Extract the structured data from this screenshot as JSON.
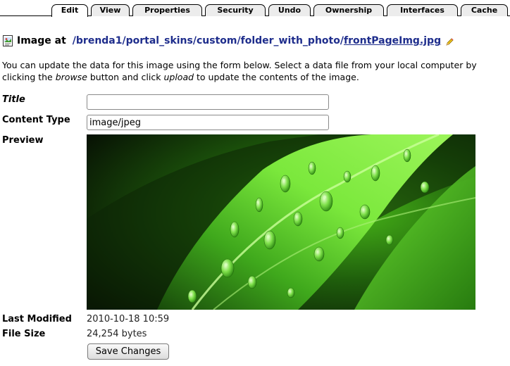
{
  "tabs": [
    {
      "label": "Edit",
      "active": true
    },
    {
      "label": "View",
      "active": false
    },
    {
      "label": "Properties",
      "active": false
    },
    {
      "label": "Security",
      "active": false
    },
    {
      "label": "Undo",
      "active": false
    },
    {
      "label": "Ownership",
      "active": false
    },
    {
      "label": "Interfaces",
      "active": false
    },
    {
      "label": "Cache",
      "active": false
    }
  ],
  "header": {
    "icon": "image-document-icon",
    "label": "Image at",
    "path": [
      "/brenda1",
      "portal_skins",
      "custom",
      "folder_with_photo",
      "frontPageImg.jpg"
    ],
    "separator": "/",
    "edit_icon": "pencil-icon"
  },
  "intro": {
    "part1": "You can update the data for this image using the form below. Select a data file from your local computer by clicking the ",
    "em1": "browse",
    "part2": " button and click ",
    "em2": "upload",
    "part3": " to update the contents of the image."
  },
  "form": {
    "title_label": "Title",
    "title_value": "",
    "content_type_label": "Content Type",
    "content_type_value": "image/jpeg",
    "preview_label": "Preview",
    "preview_image": "green-leaf-with-water-droplets",
    "last_modified_label": "Last Modified",
    "last_modified_value": "2010-10-18 10:59",
    "file_size_label": "File Size",
    "file_size_value": "24,254 bytes",
    "save_button": "Save Changes"
  },
  "colors": {
    "link": "#1e2d8c",
    "tab_bg": "#ececec",
    "leaf_green": "#5fd12a"
  }
}
